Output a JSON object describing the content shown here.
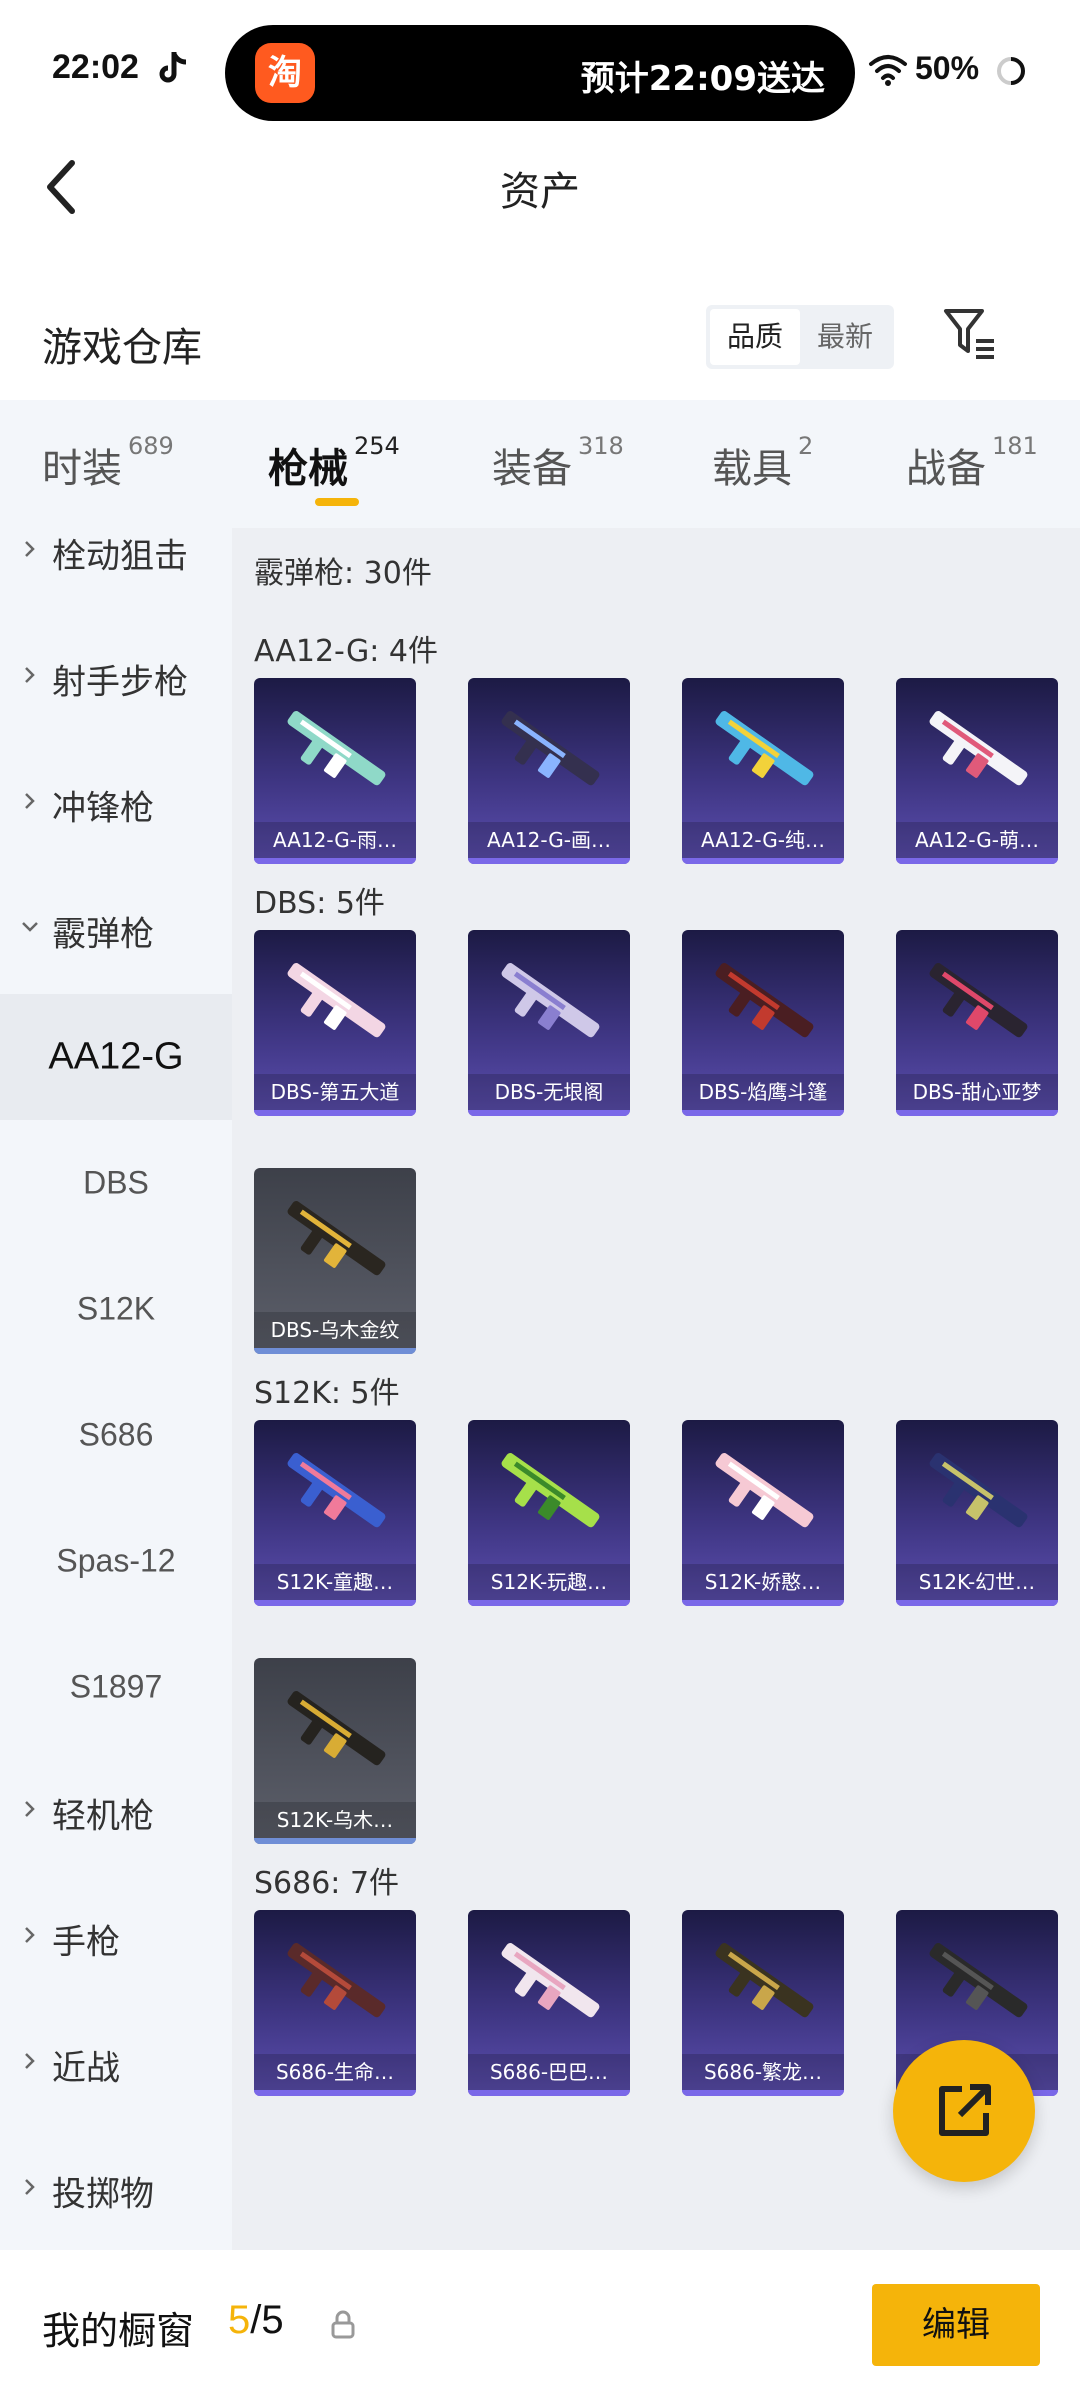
{
  "status": {
    "time": "22:02",
    "island_app": "淘",
    "island_text": "预计22:09送达",
    "battery": "50%"
  },
  "nav": {
    "title": "资产"
  },
  "warehouse": {
    "title": "游戏仓库",
    "sort_options": [
      "品质",
      "最新"
    ],
    "active_sort": "品质"
  },
  "tabs": [
    {
      "label": "时装",
      "count": "689"
    },
    {
      "label": "枪械",
      "count": "254"
    },
    {
      "label": "装备",
      "count": "318"
    },
    {
      "label": "载具",
      "count": "2"
    },
    {
      "label": "战备",
      "count": "181"
    }
  ],
  "active_tab": "枪械",
  "sidebar": [
    {
      "label": "栓动狙击",
      "kind": "category",
      "expanded": false
    },
    {
      "label": "射手步枪",
      "kind": "category",
      "expanded": false
    },
    {
      "label": "冲锋枪",
      "kind": "category",
      "expanded": false
    },
    {
      "label": "霰弹枪",
      "kind": "category",
      "expanded": true
    },
    {
      "label": "AA12-G",
      "kind": "sub",
      "selected": true
    },
    {
      "label": "DBS",
      "kind": "sub"
    },
    {
      "label": "S12K",
      "kind": "sub"
    },
    {
      "label": "S686",
      "kind": "sub"
    },
    {
      "label": "Spas-12",
      "kind": "sub"
    },
    {
      "label": "S1897",
      "kind": "sub"
    },
    {
      "label": "轻机枪",
      "kind": "category",
      "expanded": false
    },
    {
      "label": "手枪",
      "kind": "category",
      "expanded": false
    },
    {
      "label": "近战",
      "kind": "category",
      "expanded": false
    },
    {
      "label": "投掷物",
      "kind": "category",
      "expanded": false
    }
  ],
  "main": {
    "category_total": "霰弹枪: 30件",
    "sections": [
      {
        "title": "AA12-G: 4件",
        "items": [
          {
            "name": "AA12-G-雨…",
            "body": "#8fd9c8",
            "accent": "#ffffff",
            "quality": "purple"
          },
          {
            "name": "AA12-G-画…",
            "body": "#34304f",
            "accent": "#8ab4ff",
            "quality": "purple"
          },
          {
            "name": "AA12-G-纯…",
            "body": "#4fb8e6",
            "accent": "#f2d23a",
            "quality": "purple"
          },
          {
            "name": "AA12-G-萌…",
            "body": "#f4f4f8",
            "accent": "#e05a7a",
            "quality": "purple"
          }
        ]
      },
      {
        "title": "DBS: 5件",
        "items": [
          {
            "name": "DBS-第五大道",
            "body": "#f3d6e4",
            "accent": "#ffffff",
            "quality": "purple"
          },
          {
            "name": "DBS-无垠阁",
            "body": "#cfc8e8",
            "accent": "#8a7fd0",
            "quality": "purple"
          },
          {
            "name": "DBS-焰鹰斗篷",
            "body": "#4a1e22",
            "accent": "#c23a2e",
            "quality": "purple"
          },
          {
            "name": "DBS-甜心亚梦",
            "body": "#2a2430",
            "accent": "#e0486a",
            "quality": "purple"
          },
          {
            "name": "DBS-乌木金纹",
            "body": "#2a2620",
            "accent": "#e2b43a",
            "quality": "grey"
          }
        ]
      },
      {
        "title": "S12K: 5件",
        "items": [
          {
            "name": "S12K-童趣…",
            "body": "#3a5fd0",
            "accent": "#f07a9a",
            "quality": "purple"
          },
          {
            "name": "S12K-玩趣…",
            "body": "#a6e04a",
            "accent": "#3b8a2a",
            "quality": "purple"
          },
          {
            "name": "S12K-娇憨…",
            "body": "#f6c9d4",
            "accent": "#ffffff",
            "quality": "purple"
          },
          {
            "name": "S12K-幻世…",
            "body": "#2a3270",
            "accent": "#c7c26a",
            "quality": "purple"
          },
          {
            "name": "S12K-乌木…",
            "body": "#25231f",
            "accent": "#d8ac34",
            "quality": "grey"
          }
        ]
      },
      {
        "title": "S686: 7件",
        "items": [
          {
            "name": "S686-生命…",
            "body": "#5a2a2a",
            "accent": "#b44a3a",
            "quality": "purple"
          },
          {
            "name": "S686-巴巴…",
            "body": "#f1e6ee",
            "accent": "#e8a6c0",
            "quality": "purple"
          },
          {
            "name": "S686-繁龙…",
            "body": "#3a3320",
            "accent": "#c9a64a",
            "quality": "purple"
          },
          {
            "name": "",
            "body": "#2a2a2a",
            "accent": "#555555",
            "quality": "purple"
          }
        ]
      }
    ]
  },
  "bottom": {
    "title": "我的橱窗",
    "count_current": "5",
    "count_total": "/5",
    "edit_label": "编辑"
  },
  "colors": {
    "accent": "#f5b40a",
    "card_purple": "#3e3582",
    "card_grey": "#5d606b"
  }
}
